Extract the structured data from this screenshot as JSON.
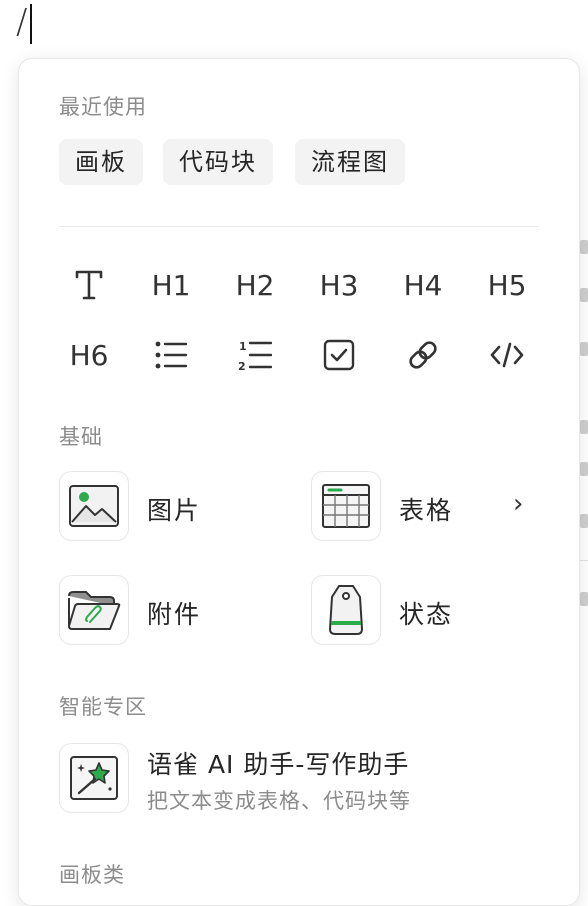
{
  "editor": {
    "typed": "/"
  },
  "menu": {
    "recent": {
      "title": "最近使用",
      "chips": [
        "画板",
        "代码块",
        "流程图"
      ]
    },
    "toolbar": {
      "row1": [
        {
          "kind": "text",
          "icon": "text-format-icon"
        },
        {
          "kind": "heading",
          "label": "H1"
        },
        {
          "kind": "heading",
          "label": "H2"
        },
        {
          "kind": "heading",
          "label": "H3"
        },
        {
          "kind": "heading",
          "label": "H4"
        },
        {
          "kind": "heading",
          "label": "H5"
        }
      ],
      "row2": [
        {
          "kind": "heading",
          "label": "H6"
        },
        {
          "kind": "icon",
          "icon": "bullet-list-icon"
        },
        {
          "kind": "icon",
          "icon": "numbered-list-icon"
        },
        {
          "kind": "icon",
          "icon": "checkbox-icon"
        },
        {
          "kind": "icon",
          "icon": "link-icon"
        },
        {
          "kind": "icon",
          "icon": "code-icon"
        }
      ]
    },
    "basic": {
      "title": "基础",
      "items": [
        {
          "label": "图片",
          "icon": "image-icon"
        },
        {
          "label": "表格",
          "icon": "table-icon",
          "chevron": "›"
        },
        {
          "label": "附件",
          "icon": "attachment-folder-icon"
        },
        {
          "label": "状态",
          "icon": "status-tag-icon"
        }
      ]
    },
    "smart": {
      "title": "智能专区",
      "item": {
        "title": "语雀 AI 助手-写作助手",
        "subtitle": "把文本变成表格、代码块等",
        "icon": "ai-magic-wand-icon"
      }
    },
    "board": {
      "title": "画板类"
    }
  },
  "colors": {
    "accent_green": "#2bab4b",
    "chip_bg": "#f3f3f3",
    "muted_text": "#8c8c8c"
  }
}
